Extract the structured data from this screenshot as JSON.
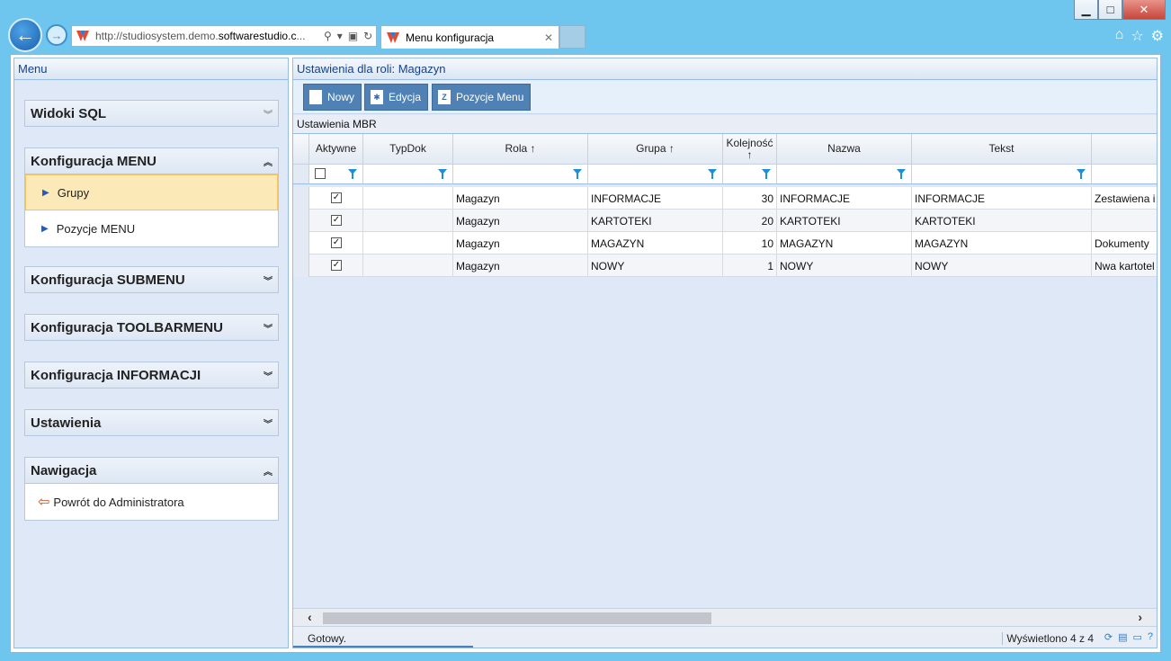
{
  "browser": {
    "url_prefix": "http://studiosystem.demo.",
    "url_domain": "softwarestudio.c",
    "url_suffix": "...",
    "tab_title": "Menu konfiguracja",
    "window_controls": [
      "minimize-icon",
      "maximize-icon",
      "close-icon"
    ],
    "right_tools": [
      "home-icon",
      "star-icon",
      "gear-icon"
    ]
  },
  "left_panel": {
    "title": "Menu",
    "sections": [
      {
        "title": "Widoki SQL",
        "expanded": false,
        "items": []
      },
      {
        "title": "Konfiguracja MENU",
        "expanded": true,
        "items": [
          "Grupy",
          "Pozycje MENU"
        ],
        "selected": "Grupy"
      },
      {
        "title": "Konfiguracja SUBMENU",
        "expanded": false,
        "items": []
      },
      {
        "title": "Konfiguracja TOOLBARMENU",
        "expanded": false,
        "items": []
      },
      {
        "title": "Konfiguracja INFORMACJI",
        "expanded": false,
        "items": []
      },
      {
        "title": "Ustawienia",
        "expanded": false,
        "items": []
      },
      {
        "title": "Nawigacja",
        "expanded": true,
        "items": [
          "Powrót do Administratora"
        ]
      }
    ]
  },
  "right_panel": {
    "title": "Ustawienia dla roli: Magazyn",
    "toolbar": {
      "new": "Nowy",
      "edit": "Edycja",
      "positions": "Pozycje Menu"
    },
    "grid_title": "Ustawienia MBR",
    "columns": {
      "aktywne": "Aktywne",
      "typdok": "TypDok",
      "rola": "Rola ↑",
      "grupa": "Grupa ↑",
      "kolejnosc": "Kolejność ↑",
      "nazwa": "Nazwa",
      "tekst": "Tekst"
    },
    "rows": [
      {
        "aktywne": true,
        "typdok": "",
        "rola": "Magazyn",
        "grupa": "INFORMACJE",
        "kolejnosc": "30",
        "nazwa": "INFORMACJE",
        "tekst": "INFORMACJE",
        "extra": "Zestawiena i"
      },
      {
        "aktywne": true,
        "typdok": "",
        "rola": "Magazyn",
        "grupa": "KARTOTEKI",
        "kolejnosc": "20",
        "nazwa": "KARTOTEKI",
        "tekst": "KARTOTEKI",
        "extra": ""
      },
      {
        "aktywne": true,
        "typdok": "",
        "rola": "Magazyn",
        "grupa": "MAGAZYN",
        "kolejnosc": "10",
        "nazwa": "MAGAZYN",
        "tekst": "MAGAZYN",
        "extra": "Dokumenty"
      },
      {
        "aktywne": true,
        "typdok": "",
        "rola": "Magazyn",
        "grupa": "NOWY",
        "kolejnosc": "1",
        "nazwa": "NOWY",
        "tekst": "NOWY",
        "extra": "Nwa kartotel"
      }
    ],
    "status": {
      "ready": "Gotowy.",
      "count": "Wyświetlono 4 z 4"
    }
  }
}
